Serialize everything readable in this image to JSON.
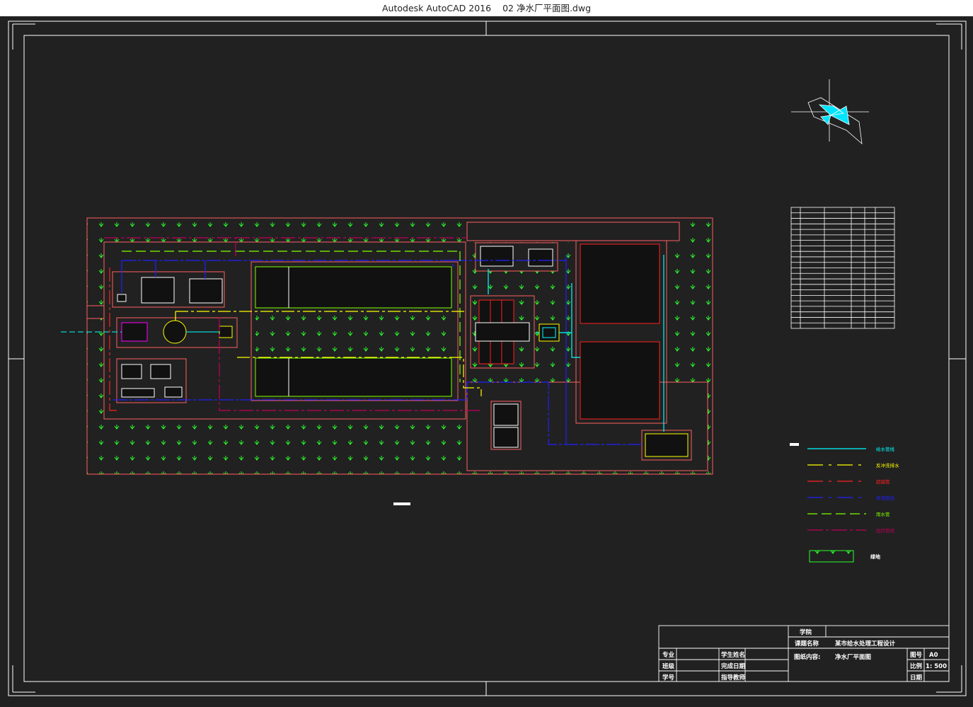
{
  "window": {
    "app_name": "Autodesk AutoCAD 2016",
    "file_name": "02 净水厂平面图.dwg"
  },
  "drawing": {
    "title_block": {
      "school_label": "学院",
      "project_label": "课题名称",
      "project_value": "某市给水处理工程设计",
      "drawing_name_label": "图纸内容:",
      "drawing_name_value": "净水厂平面图",
      "major_label": "专业",
      "class_label": "班级",
      "student_no_label": "学号",
      "student_name_label": "学生姓名",
      "date_label": "完成日期",
      "advisor_label": "指导教师",
      "sheet_no_label": "图号",
      "sheet_no_value": "A0",
      "scale_label": "比例",
      "scale_value": "1: 500",
      "sheet_date_label": "日期"
    },
    "legend": {
      "lines": [
        {
          "color": "#00ffff",
          "label": "给水管线"
        },
        {
          "color": "#ffff00",
          "label": "反冲洗排水"
        },
        {
          "color": "#ff2020",
          "label": "超越管"
        },
        {
          "color": "#2020ff",
          "label": "排泥管线"
        },
        {
          "color": "#80ff00",
          "label": "雨水管"
        },
        {
          "color": "#c0005a",
          "label": "加药管线"
        }
      ],
      "green_area_label": "绿地"
    },
    "table_rows": 22
  }
}
